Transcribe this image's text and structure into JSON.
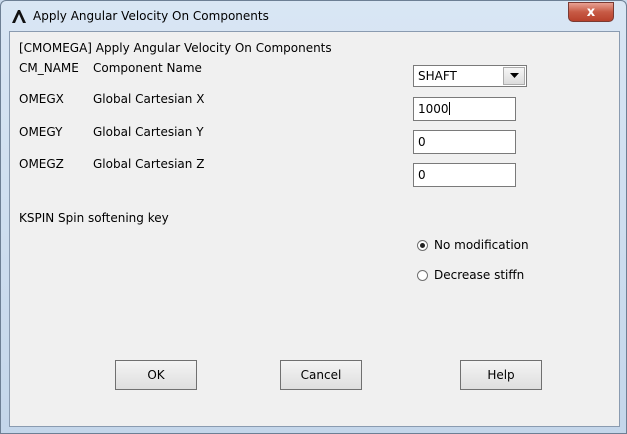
{
  "window": {
    "title": "Apply Angular Velocity On Components",
    "close_glyph": "x"
  },
  "form": {
    "header": "[CMOMEGA] Apply Angular Velocity On Components",
    "cm_name": {
      "code": "CM_NAME",
      "label": "Component Name",
      "value": "SHAFT"
    },
    "omegx": {
      "code": "OMEGX",
      "label": "Global Cartesian X",
      "value": "1000"
    },
    "omegy": {
      "code": "OMEGY",
      "label": "Global Cartesian Y",
      "value": "0"
    },
    "omegz": {
      "code": "OMEGZ",
      "label": "Global Cartesian Z",
      "value": "0"
    },
    "kspin": {
      "label": "KSPIN  Spin softening key",
      "options": [
        {
          "label": "No modification",
          "selected": true
        },
        {
          "label": "Decrease stiffn",
          "selected": false
        }
      ]
    }
  },
  "buttons": {
    "ok": "OK",
    "cancel": "Cancel",
    "help": "Help"
  }
}
